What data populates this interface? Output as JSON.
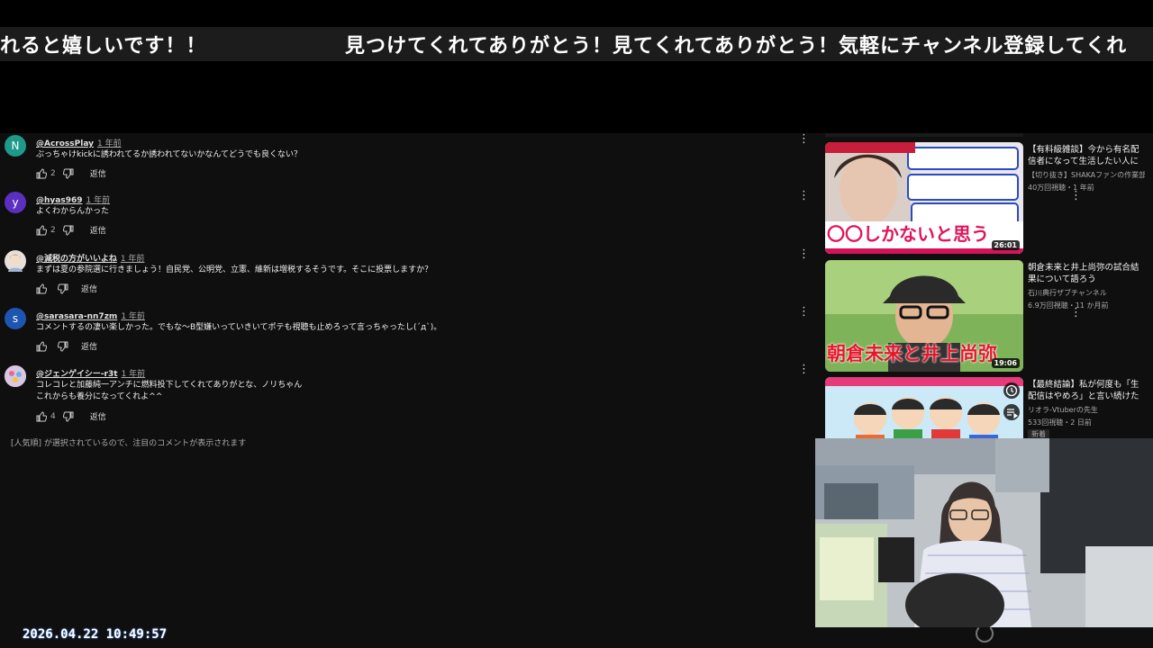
{
  "ticker": {
    "segment_1": "れると嬉しいです！！",
    "segment_2": "見つけてくれてありがとう！見てくれてありがとう！気軽にチャンネル登録してくれ"
  },
  "comments": [
    {
      "avatar_letter": "N",
      "avatar_color": "#1e9a8a",
      "author": "@AcrossPlay",
      "time": "1 年前",
      "text_lines": [
        "ぶっちゃけkickに誘われてるか誘われてないかなんてどうでも良くない？"
      ],
      "likes": "2",
      "reply": "返信"
    },
    {
      "avatar_letter": "y",
      "avatar_color": "#5b2fc0",
      "author": "@hyas969",
      "time": "1 年前",
      "text_lines": [
        "よくわからんかった"
      ],
      "likes": "2",
      "reply": "返信"
    },
    {
      "avatar_letter": "",
      "avatar_color": "#e8e0d8",
      "author": "@減税の方がいいよね",
      "time": "1 年前",
      "text_lines": [
        "まずは夏の参院選に行きましょう！自民党、公明党、立憲、維新は増税するそうです。そこに投票しますか？"
      ],
      "likes": "",
      "reply": "返信"
    },
    {
      "avatar_letter": "s",
      "avatar_color": "#1d55b0",
      "author": "@sarasara-nn7zm",
      "time": "1 年前",
      "text_lines": [
        "コメントするの凄い楽しかった。でもな〜B型嫌いっていきいてポテも視聴も止めろって言っちゃったし(´д`)。"
      ],
      "likes": "",
      "reply": "返信"
    },
    {
      "avatar_letter": "",
      "avatar_color": "#c8a0c8",
      "author": "@ジェンゲイシー-r3t",
      "time": "1 年前",
      "text_lines": [
        "コレコレと加藤純一アンチに燃料投下してくれてありがとな、ノリちゃん",
        "これからも養分になってくれよ^^"
      ],
      "likes": "4",
      "reply": "返信"
    }
  ],
  "notice": "[人気順] が選択されているので、注目のコメントが表示されます",
  "clock": "2026.04.22  10:49:57",
  "sidebar": {
    "videos": [
      {
        "title": "【有料級雑談】今から有名配信者になって生活したい人にア…",
        "channel": "【切り抜き】SHAKAファンの作業部…",
        "meta": "40万回視聴・1 年前",
        "duration": "26:01",
        "thumb_text": "〇〇しかないと思う"
      },
      {
        "title": "朝倉未来と井上尚弥の試合結果について語ろう",
        "channel": "石川典行ザブチャンネル",
        "meta": "6.9万回視聴・11 か月前",
        "duration": "19:06",
        "thumb_text": "朝倉未来と井上尚弥"
      },
      {
        "title": "【最終結論】私が何度も「生配信はやめろ」と言い続けた本当…",
        "channel": "リオラ-Vtuberの先生",
        "meta": "533回視聴・2 日前",
        "duration": "",
        "thumb_text": "",
        "badge": "新着"
      }
    ]
  }
}
